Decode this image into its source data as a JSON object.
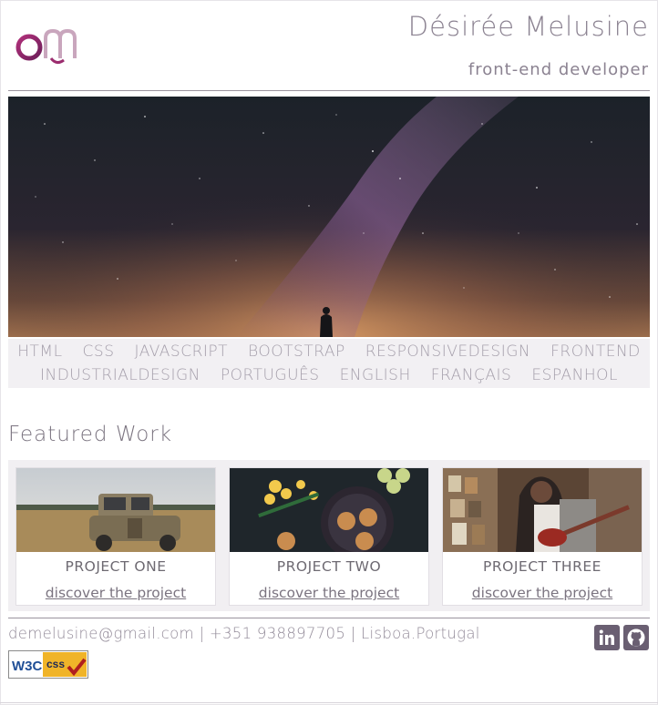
{
  "header": {
    "logo_text": "dm",
    "name": "Désirée Melusine",
    "role": "front-end developer"
  },
  "hero": {
    "image": "night-sky-milky-way-person-silhouette"
  },
  "tags": {
    "row1": [
      "HTML",
      "CSS",
      "JAVASCRIPT",
      "BOOTSTRAP",
      "RESPONSIVEDESIGN",
      "FRONTEND"
    ],
    "row2": [
      "INDUSTRIALDESIGN",
      "PORTUGUÊS",
      "ENGLISH",
      "FRANÇAIS",
      "ESPANHOL"
    ]
  },
  "featured": {
    "title": "Featured Work",
    "projects": [
      {
        "title": "PROJECT ONE",
        "link": "discover the project",
        "image": "vintage-truck-field"
      },
      {
        "title": "PROJECT TWO",
        "link": "discover the project",
        "image": "cookies-flowers-table"
      },
      {
        "title": "PROJECT THREE",
        "link": "discover the project",
        "image": "woman-guitar-record-shop"
      }
    ]
  },
  "footer": {
    "contact": "demelusine@gmail.com | +351 938897705 | Lisboa.Portugal",
    "social_icons": [
      "linkedin-icon",
      "github-icon"
    ],
    "badge": {
      "left": "W3C",
      "right": "css"
    }
  },
  "colors": {
    "accent": "#6a5f72",
    "logo": "#9b2c6e",
    "text": "#8b8291"
  }
}
